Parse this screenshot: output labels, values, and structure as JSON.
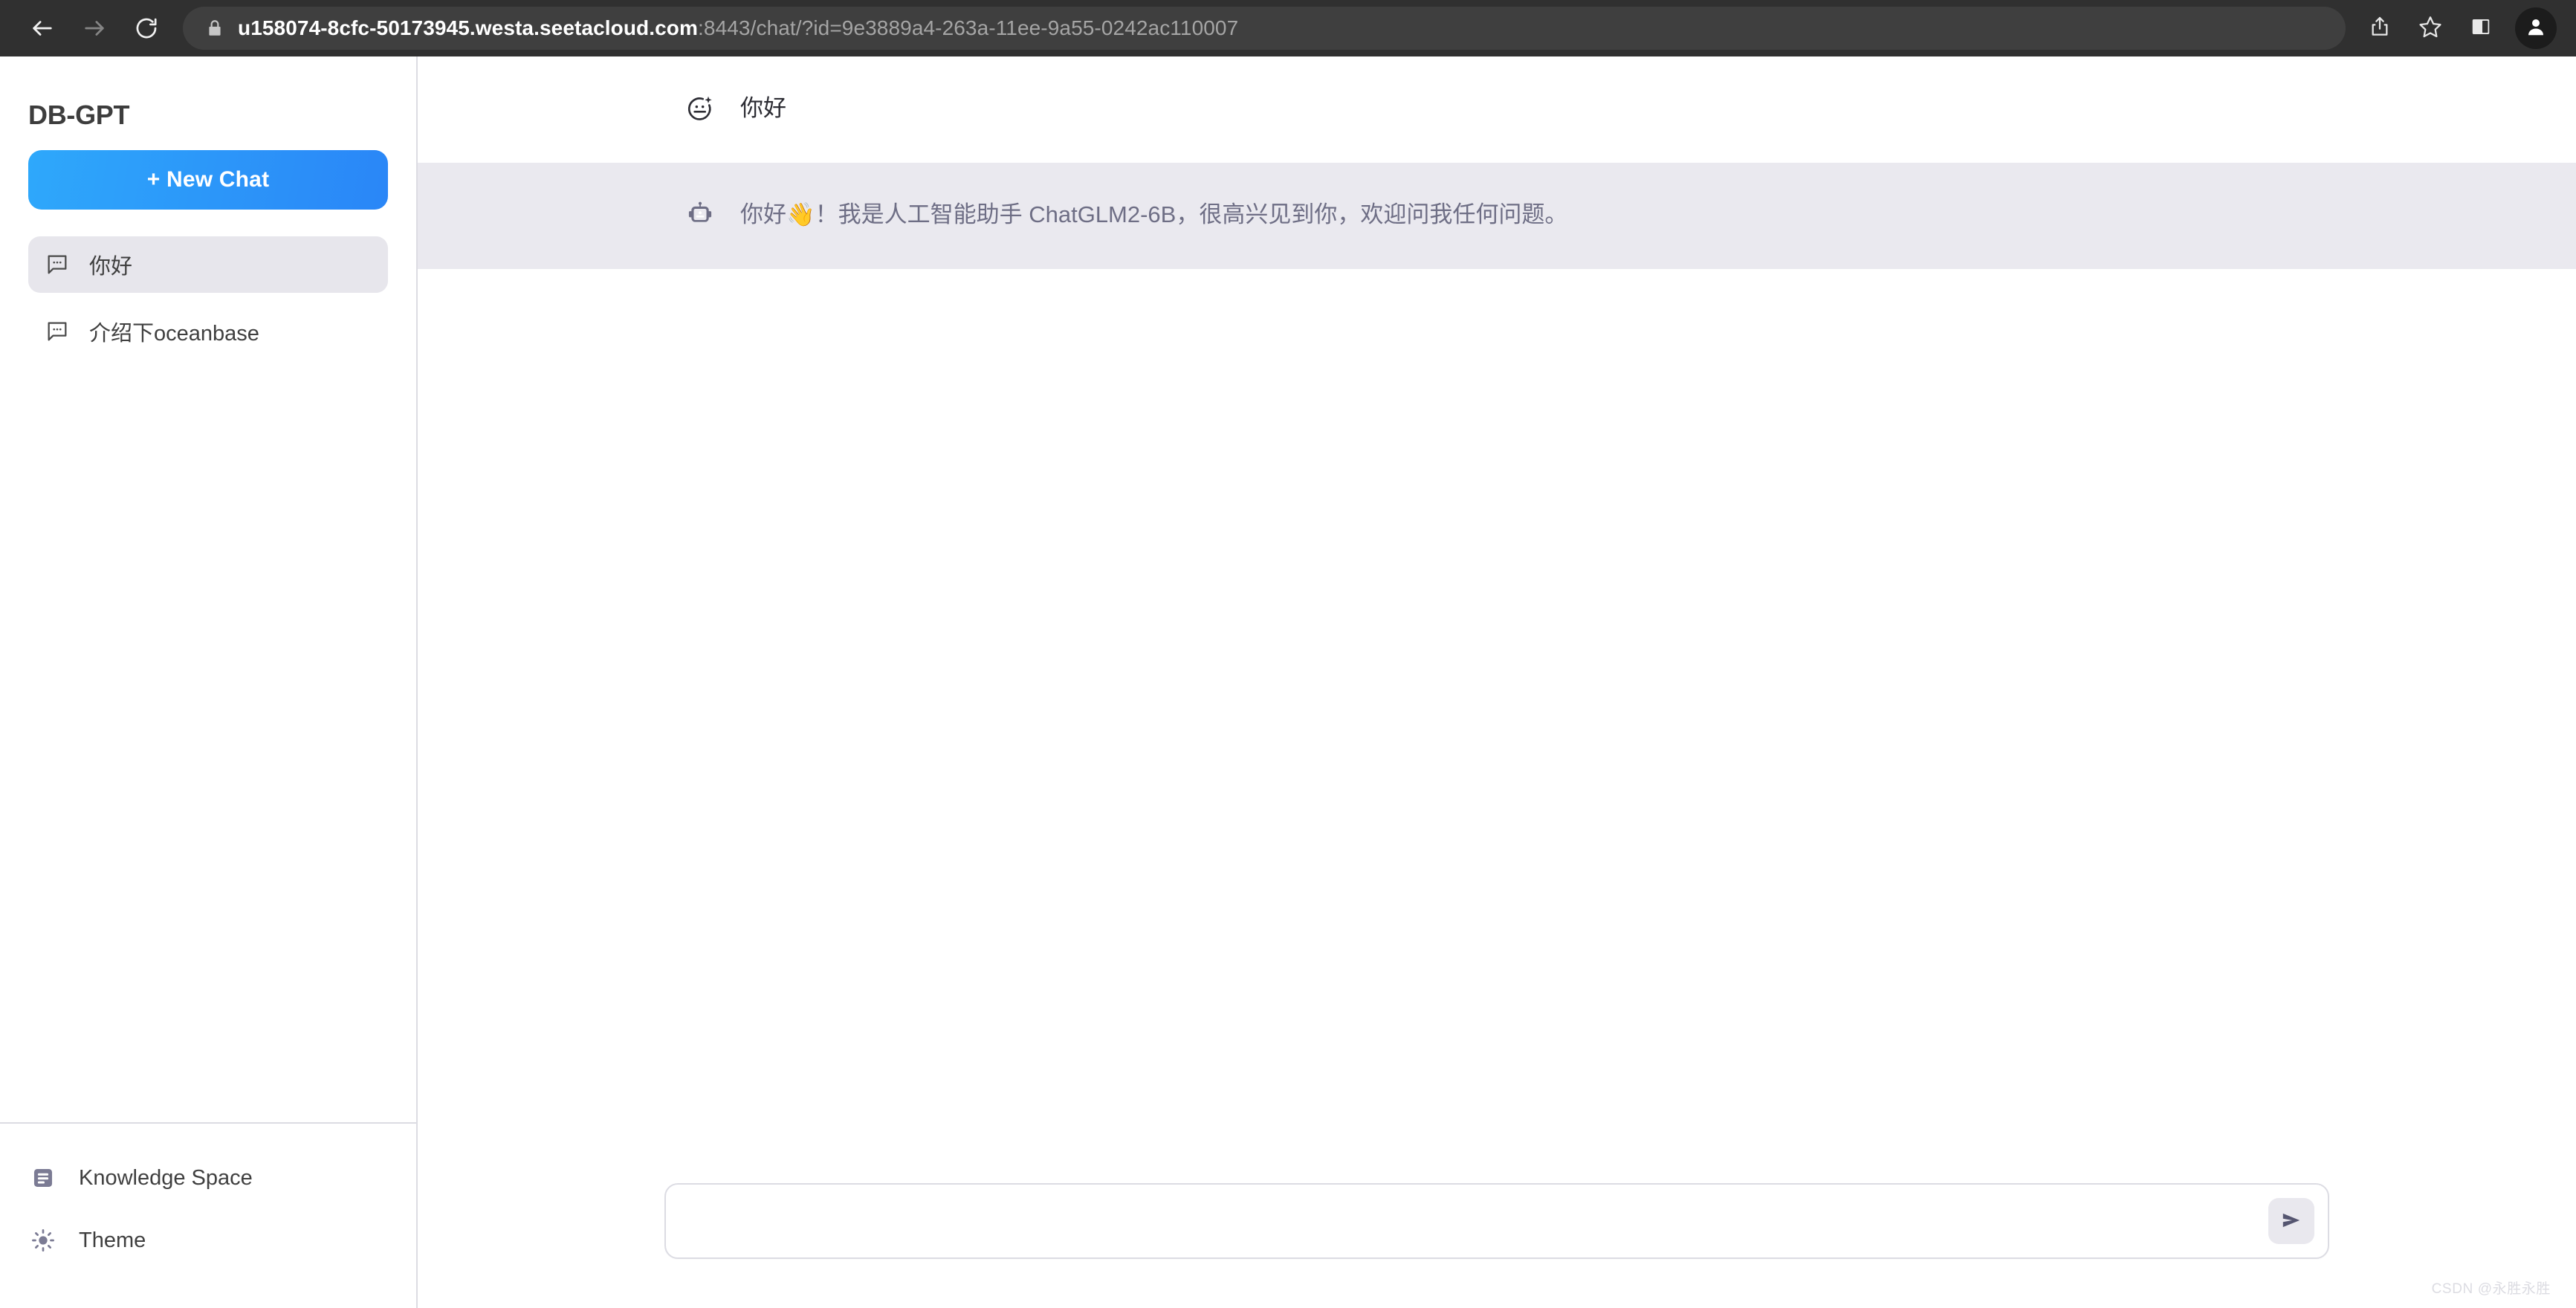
{
  "browser": {
    "url_host": "u158074-8cfc-50173945.westa.seetacloud.com",
    "url_path": ":8443/chat/?id=9e3889a4-263a-11ee-9a55-0242ac110007",
    "back_icon": "back-arrow-icon",
    "forward_icon": "forward-arrow-icon",
    "reload_icon": "reload-icon",
    "lock_icon": "lock-icon",
    "share_icon": "share-icon",
    "bookmark_icon": "star-icon",
    "sidepanel_icon": "side-panel-icon",
    "profile_icon": "profile-avatar-icon"
  },
  "sidebar": {
    "brand": "DB-GPT",
    "new_chat_label": "+ New Chat",
    "chats": [
      {
        "label": "你好",
        "icon": "chat-bubble-icon",
        "active": true
      },
      {
        "label": "介绍下oceanbase",
        "icon": "chat-bubble-icon",
        "active": false
      }
    ],
    "bottom_items": [
      {
        "label": "Knowledge Space",
        "icon": "knowledge-space-icon"
      },
      {
        "label": "Theme",
        "icon": "sun-icon"
      }
    ]
  },
  "main": {
    "messages": [
      {
        "role": "user",
        "avatar_icon": "user-sparkle-face-icon",
        "text": "你好"
      },
      {
        "role": "assistant",
        "avatar_icon": "robot-icon",
        "text": "你好👋！我是人工智能助手 ChatGLM2-6B，很高兴见到你，欢迎问我任何问题。"
      }
    ],
    "composer": {
      "value": "",
      "placeholder": "",
      "send_icon": "send-arrow-icon"
    }
  },
  "watermark": "CSDN @永胜永胜",
  "colors": {
    "accent": "#2a86f7",
    "assistant_row_bg": "#eae9ef",
    "assistant_text": "#6e6e85",
    "sidebar_active_bg": "#e7e6ec",
    "chrome_bg": "#303030"
  }
}
